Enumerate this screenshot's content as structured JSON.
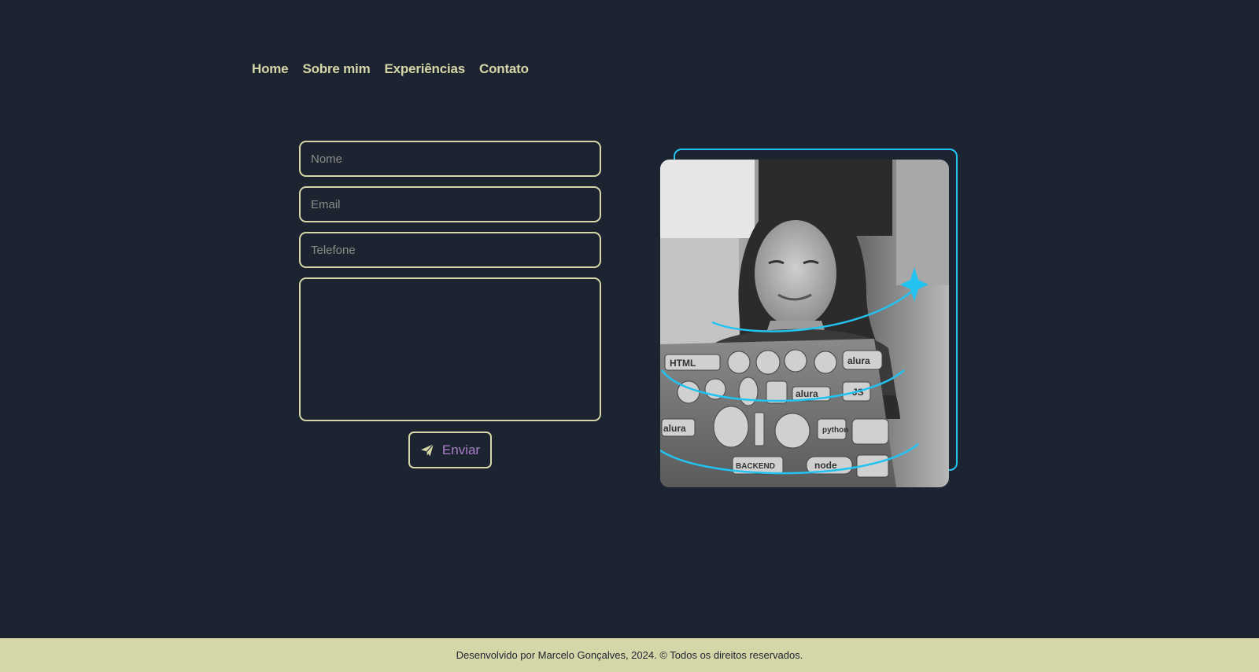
{
  "nav": {
    "items": [
      {
        "label": "Home"
      },
      {
        "label": "Sobre mim"
      },
      {
        "label": "Experiências"
      },
      {
        "label": "Contato"
      }
    ]
  },
  "form": {
    "name_placeholder": "Nome",
    "email_placeholder": "Email",
    "phone_placeholder": "Telefone",
    "message_placeholder": "",
    "submit_label": "Enviar",
    "submit_icon": "paper-plane-icon"
  },
  "hero_image": {
    "description_icon": "woman-with-laptop-photo",
    "sticker_texts": [
      "HTML",
      "alura",
      "JS",
      "alura",
      "python",
      "alura",
      "BACKEND",
      "node"
    ]
  },
  "footer": {
    "text": "Desenvolvido por Marcelo Gonçalves, 2024. © Todos os direitos reservados."
  },
  "colors": {
    "background": "#1c2331",
    "accent": "#d6d7a8",
    "highlight": "#22c3f0",
    "button_text": "#a97fc6"
  }
}
